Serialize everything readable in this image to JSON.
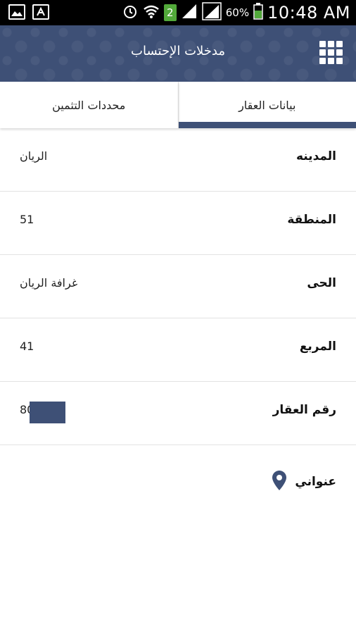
{
  "status_bar": {
    "notification_count": "2",
    "battery": "60%",
    "time": "10:48 AM"
  },
  "header": {
    "title": "مدخلات الإحتساب",
    "menu_icon": "grid-icon"
  },
  "tabs": [
    {
      "label": "محددات التثمين",
      "active": false
    },
    {
      "label": "بيانات العقار",
      "active": true
    }
  ],
  "fields": [
    {
      "label": "المدينه",
      "value": "الريان"
    },
    {
      "label": "المنطقة",
      "value": "51"
    },
    {
      "label": "الحى",
      "value": "غرافة الريان"
    },
    {
      "label": "المربع",
      "value": "41"
    },
    {
      "label": "رقم العقار",
      "value": "80"
    }
  ],
  "address": {
    "label": "عنواني",
    "icon": "location-pin-icon"
  },
  "colors": {
    "header_bg": "#3e5076",
    "active_tab_indicator": "#3e5076"
  }
}
